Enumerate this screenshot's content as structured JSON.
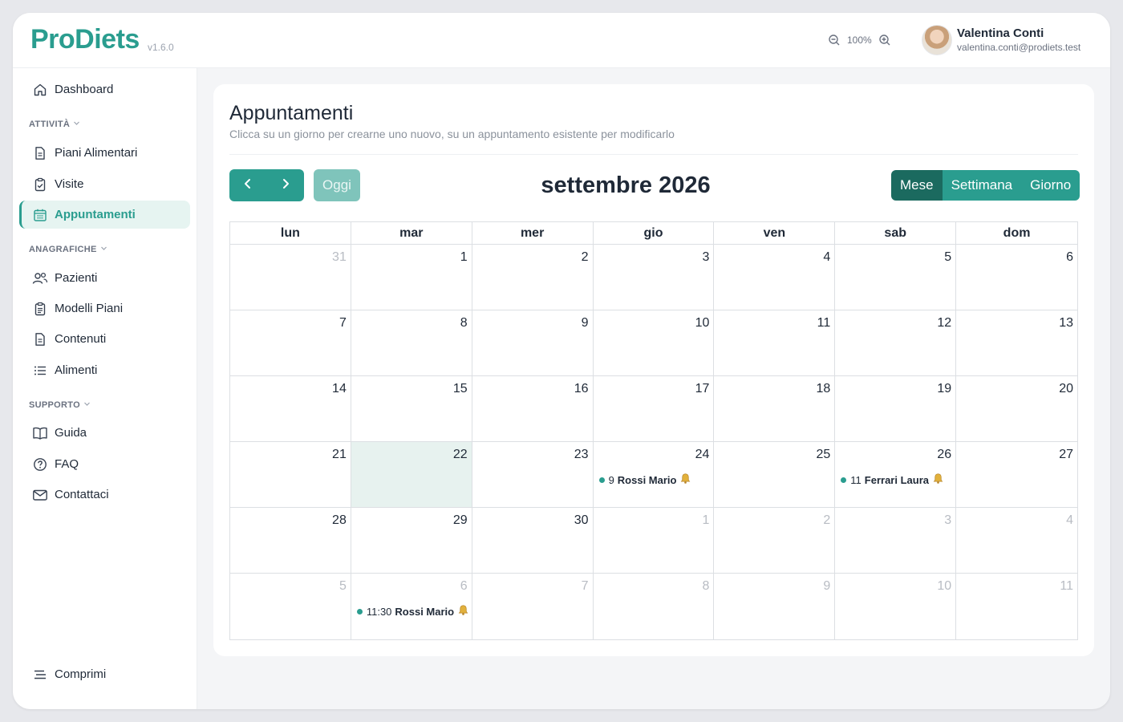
{
  "app": {
    "name": "ProDiets",
    "version": "v1.6.0"
  },
  "header": {
    "zoom_level": "100%",
    "user": {
      "name": "Valentina Conti",
      "email": "valentina.conti@prodiets.test"
    }
  },
  "sidebar": {
    "dashboard": "Dashboard",
    "sections": {
      "attivita": "ATTIVITÀ",
      "anagrafiche": "ANAGRAFICHE",
      "supporto": "SUPPORTO"
    },
    "items": {
      "piani_alimentari": "Piani Alimentari",
      "visite": "Visite",
      "appuntamenti": "Appuntamenti",
      "pazienti": "Pazienti",
      "modelli_piani": "Modelli Piani",
      "contenuti": "Contenuti",
      "alimenti": "Alimenti",
      "guida": "Guida",
      "faq": "FAQ",
      "contattaci": "Contattaci"
    },
    "collapse": "Comprimi"
  },
  "page": {
    "title": "Appuntamenti",
    "subtitle": "Clicca su un giorno per crearne uno nuovo, su un appuntamento esistente per modificarlo"
  },
  "calendar": {
    "today_label": "Oggi",
    "title": "settembre 2026",
    "views": {
      "month": "Mese",
      "week": "Settimana",
      "day": "Giorno"
    },
    "weekdays": [
      "lun",
      "mar",
      "mer",
      "gio",
      "ven",
      "sab",
      "dom"
    ],
    "weeks": [
      [
        {
          "d": "31",
          "o": true
        },
        {
          "d": "1"
        },
        {
          "d": "2"
        },
        {
          "d": "3"
        },
        {
          "d": "4"
        },
        {
          "d": "5"
        },
        {
          "d": "6"
        }
      ],
      [
        {
          "d": "7"
        },
        {
          "d": "8"
        },
        {
          "d": "9"
        },
        {
          "d": "10"
        },
        {
          "d": "11"
        },
        {
          "d": "12"
        },
        {
          "d": "13"
        }
      ],
      [
        {
          "d": "14"
        },
        {
          "d": "15"
        },
        {
          "d": "16"
        },
        {
          "d": "17"
        },
        {
          "d": "18"
        },
        {
          "d": "19"
        },
        {
          "d": "20"
        }
      ],
      [
        {
          "d": "21"
        },
        {
          "d": "22",
          "today": true
        },
        {
          "d": "23"
        },
        {
          "d": "24",
          "event": {
            "time": "9",
            "name": "Rossi Mario"
          }
        },
        {
          "d": "25"
        },
        {
          "d": "26",
          "event": {
            "time": "11",
            "name": "Ferrari Laura"
          }
        },
        {
          "d": "27"
        }
      ],
      [
        {
          "d": "28"
        },
        {
          "d": "29"
        },
        {
          "d": "30"
        },
        {
          "d": "1",
          "o": true
        },
        {
          "d": "2",
          "o": true
        },
        {
          "d": "3",
          "o": true
        },
        {
          "d": "4",
          "o": true
        }
      ],
      [
        {
          "d": "5",
          "o": true
        },
        {
          "d": "6",
          "o": true,
          "event": {
            "time": "11:30",
            "name": "Rossi Mario"
          }
        },
        {
          "d": "7",
          "o": true
        },
        {
          "d": "8",
          "o": true
        },
        {
          "d": "9",
          "o": true
        },
        {
          "d": "10",
          "o": true
        },
        {
          "d": "11",
          "o": true
        }
      ]
    ]
  },
  "colors": {
    "brand": "#2a9d8f",
    "brand_dark": "#1b6a5f",
    "today_bg": "#e7f2ef"
  }
}
